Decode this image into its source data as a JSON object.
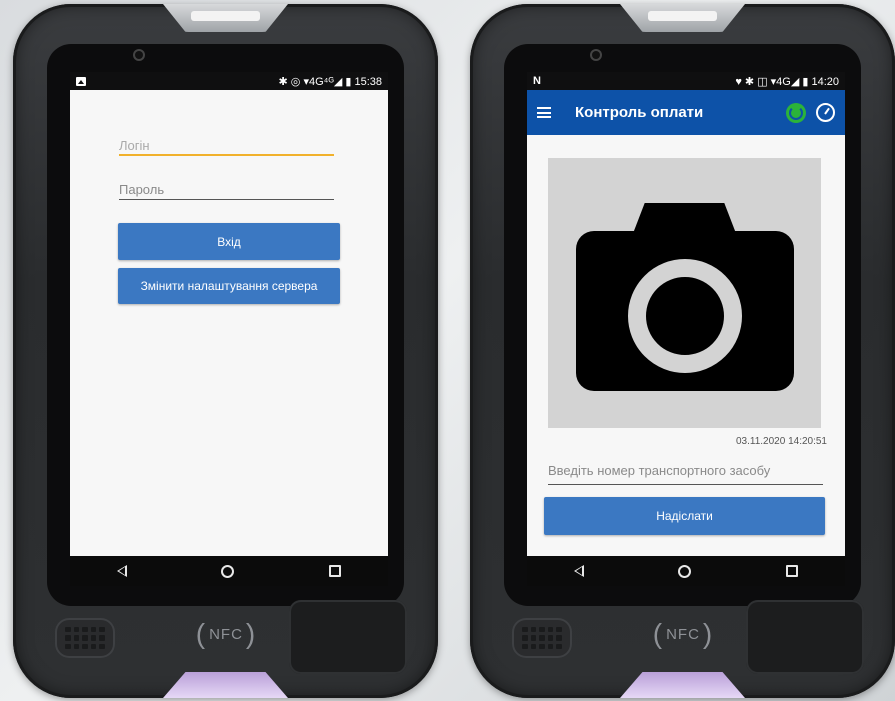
{
  "left_device": {
    "status": {
      "right_text": "✱ ◎ ▾4G⁴ᴳ◢ ▮ 15:38"
    },
    "login": {
      "username_placeholder": "Логін",
      "password_placeholder": "Пароль",
      "login_button": "Вхід",
      "server_button": "Змінити налаштування сервера"
    },
    "nfc_label": "NFC"
  },
  "right_device": {
    "status": {
      "left_text": "N",
      "right_text": "♥ ✱ ◫ ▾4G◢ ▮ 14:20"
    },
    "appbar": {
      "title": "Контроль оплати"
    },
    "photo": {
      "timestamp": "03.11.2020  14:20:51"
    },
    "vehicle_input_placeholder": "Введіть номер транспортного засобу",
    "submit_button": "Надіслати",
    "nfc_label": "NFC"
  },
  "colors": {
    "accent_blue": "#3b78c2",
    "appbar_blue": "#0d52a8",
    "active_field_underline": "#f1b12b",
    "power_green": "#2bb33a"
  },
  "icons": [
    "gallery-icon",
    "bluetooth-icon",
    "signal-icon",
    "battery-icon",
    "menu-icon",
    "power-icon",
    "timer-icon",
    "camera-icon",
    "back-icon",
    "home-icon",
    "recent-apps-icon"
  ]
}
